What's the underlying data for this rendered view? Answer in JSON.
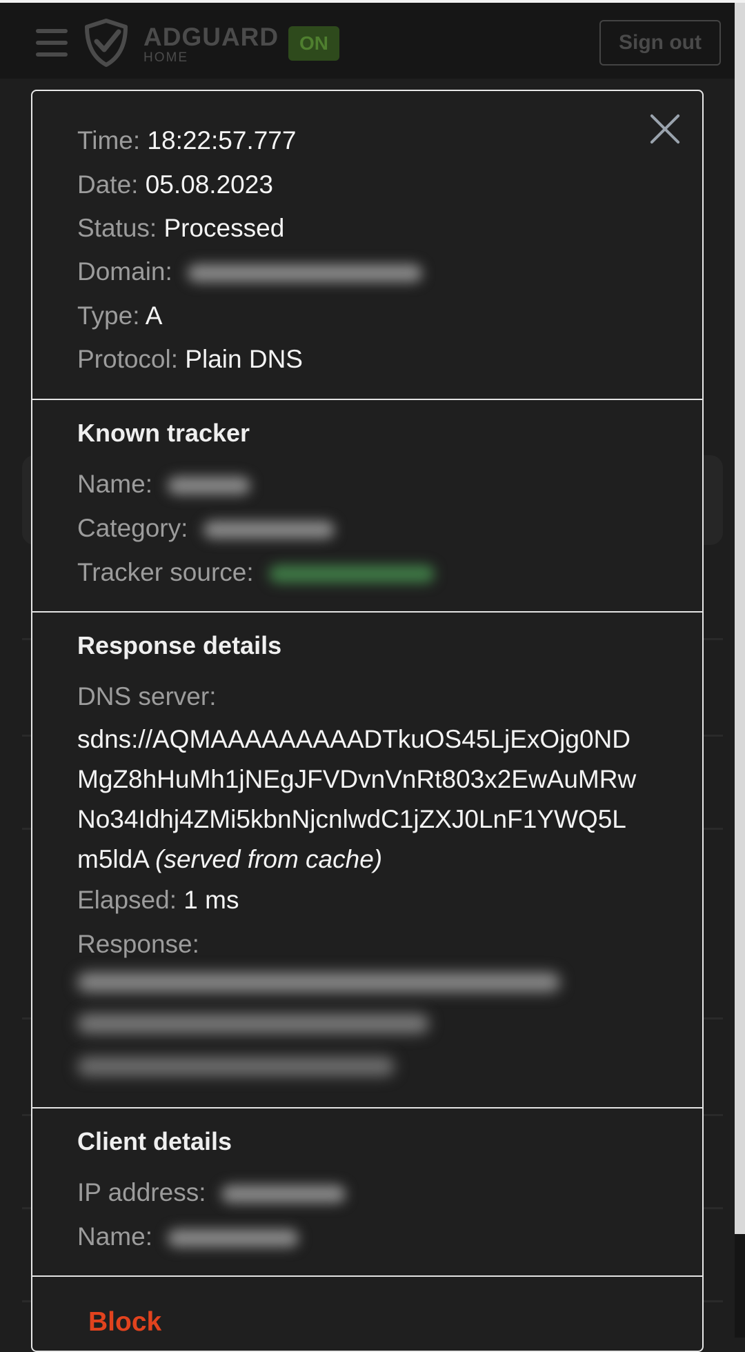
{
  "header": {
    "brand": "ADGUARD",
    "brand_sub": "HOME",
    "status_badge": "ON",
    "signout_label": "Sign out"
  },
  "query": {
    "time_label": "Time:",
    "time": "18:22:57.777",
    "date_label": "Date:",
    "date": "05.08.2023",
    "status_label": "Status:",
    "status": "Processed",
    "domain_label": "Domain:",
    "type_label": "Type:",
    "type": "A",
    "protocol_label": "Protocol:",
    "protocol": "Plain DNS"
  },
  "tracker": {
    "heading": "Known tracker",
    "name_label": "Name:",
    "category_label": "Category:",
    "source_label": "Tracker source:"
  },
  "response": {
    "heading": "Response details",
    "dns_server_label": "DNS server:",
    "dns_server": "sdns://AQMAAAAAAAAADTkuOS45LjExOjg0ND\nMgZ8hHuMh1jNEgJFVDvnVnRt803x2EwAuMRw\nNo34Idhj4ZMi5kbnNjcnlwdC1jZXJ0LnF1YWQ5L\nm5ldA",
    "cache_note": "(served from cache)",
    "elapsed_label": "Elapsed:",
    "elapsed": "1 ms",
    "response_label": "Response:"
  },
  "client": {
    "heading": "Client details",
    "ip_label": "IP address:",
    "name_label": "Name:"
  },
  "actions": {
    "block_label": "Block"
  },
  "colors": {
    "background": "#1e1e1e",
    "brand_green": "#2e4a1c",
    "block_red": "#e2431e"
  }
}
